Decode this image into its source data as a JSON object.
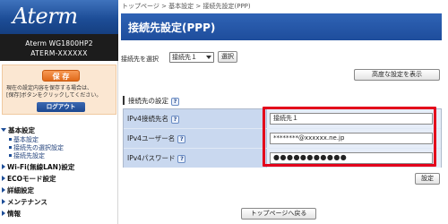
{
  "sidebar": {
    "logo": "Aterm",
    "model_name": "Aterm WG1800HP2",
    "model_id": "ATERM-XXXXXX",
    "save_label": "保 存",
    "save_note_line1": "現在の設定内容を保存する場合は、",
    "save_note_line2": "[保存]ボタンをクリックしてください。",
    "logout_label": "ログアウト",
    "nav": [
      {
        "label": "基本設定",
        "expanded": true
      },
      {
        "label": "Wi-Fi(無線LAN)設定"
      },
      {
        "label": "ECOモード設定"
      },
      {
        "label": "詳細設定"
      },
      {
        "label": "メンテナンス"
      },
      {
        "label": "情報"
      }
    ],
    "subnav": [
      "基本設定",
      "接続先の選択設定",
      "接続先設定"
    ]
  },
  "main": {
    "breadcrumb": "トップページ > 基本設定 > 接続先設定(PPP)",
    "title": "接続先設定(PPP)",
    "select_label": "接続先を選択",
    "select_value": "接続先１",
    "select_button": "選択",
    "advanced_button": "高度な設定を表示",
    "section_title": "接続先の設定",
    "help_glyph": "?",
    "rows": [
      {
        "label": "IPv4接続先名",
        "value": "接続先１"
      },
      {
        "label": "IPv4ユーザー名",
        "value": "********@xxxxxx.ne.jp"
      },
      {
        "label": "IPv4パスワード",
        "value": "●●●●●●●●●●●"
      }
    ],
    "set_button": "設定",
    "top_button": "トップページへ戻る"
  },
  "colors": {
    "header_blue": "#1e4d9c",
    "highlight_red": "#e3001b",
    "save_orange": "#e06a1a"
  }
}
